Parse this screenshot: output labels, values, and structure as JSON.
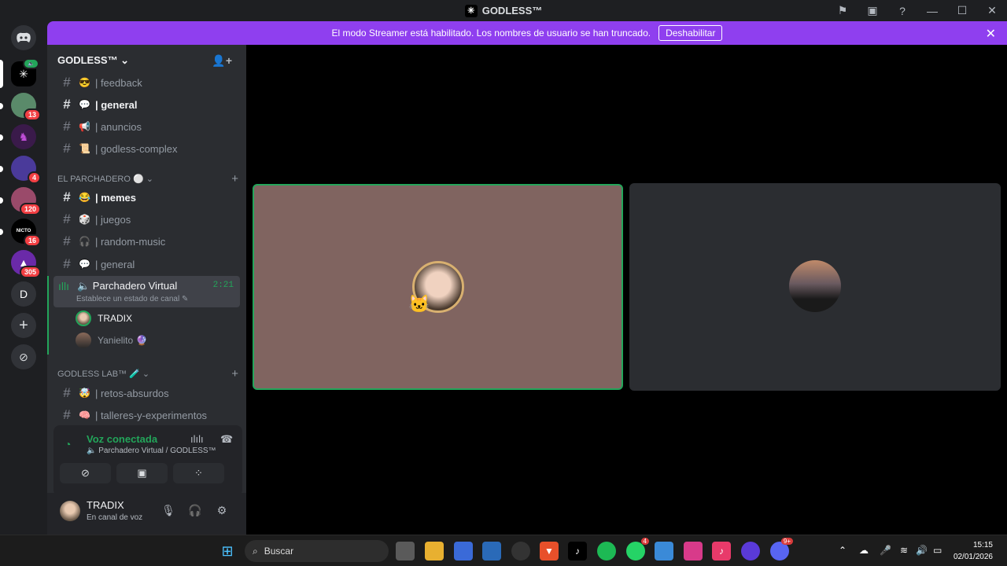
{
  "window": {
    "title": "GODLESS™"
  },
  "banner": {
    "text": "El modo Streamer está habilitado. Los nombres de usuario se han truncado.",
    "button": "Deshabilitar"
  },
  "guilds": {
    "badges": [
      "13",
      "4",
      "120",
      "16",
      "305"
    ],
    "letter": "D"
  },
  "server": {
    "name": "GODLESS™ ⌄"
  },
  "channels": {
    "feedback": "| feedback",
    "general": "| general",
    "anuncios": "| anuncios",
    "complex": "| godless-complex",
    "cat1": "EL PARCHADERO ⚪ ⌄",
    "memes": "| memes",
    "juegos": "| juegos",
    "music": "| random-music",
    "general2": "| general",
    "cat2": "GODLESS LAB™ 🧪 ⌄",
    "retos": "| retos-absurdos",
    "talleres": "| talleres-y-experimentos"
  },
  "voice": {
    "name": "🔈 Parchadero Virtual",
    "time": "2:21",
    "status": "Establece un estado de canal ✎",
    "users": [
      "TRADIX",
      "Yanielito 🔮"
    ]
  },
  "rtc": {
    "title": "Voz conectada",
    "subtitle": "🔈 Parchadero Virtual / GODLESS™"
  },
  "user": {
    "name": "TRADIX",
    "status": "En canal de voz"
  },
  "taskbar": {
    "search": "Buscar",
    "time": "15:15",
    "date": "02/01/2026",
    "wa_badge": "4",
    "discord_badge": "9+"
  },
  "colors": {
    "accent": "#8f3fef",
    "green": "#23a55a",
    "tile": "#806460"
  }
}
